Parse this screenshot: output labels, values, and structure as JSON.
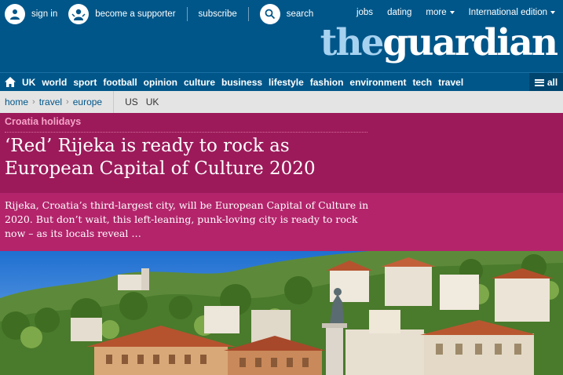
{
  "header": {
    "sign_in": "sign in",
    "become_supporter": "become a supporter",
    "subscribe": "subscribe",
    "search": "search",
    "jobs": "jobs",
    "dating": "dating",
    "more": "more",
    "edition": "International edition",
    "logo_the": "the",
    "logo_guardian": "guardian"
  },
  "nav": {
    "items": [
      "UK",
      "world",
      "sport",
      "football",
      "opinion",
      "culture",
      "business",
      "lifestyle",
      "fashion",
      "environment",
      "tech",
      "travel"
    ],
    "all": "all"
  },
  "breadcrumb": {
    "home": "home",
    "travel": "travel",
    "europe": "europe",
    "editions": [
      "US",
      "UK"
    ]
  },
  "article": {
    "series": "Croatia holidays",
    "headline": "‘Red’ Rijeka is ready to rock as European Capital of Culture 2020",
    "standfirst": "Rijeka, Croatia’s third-largest city, will be European Capital of Culture in 2020. But don’t wait, this left-leaning, punk-loving city is ready to rock now – as its locals reveal …"
  },
  "colors": {
    "brand_blue": "#005689",
    "headline_bg": "#9c1a5a",
    "standfirst_bg": "#b3246b",
    "series_pink": "#f5a3c8"
  }
}
